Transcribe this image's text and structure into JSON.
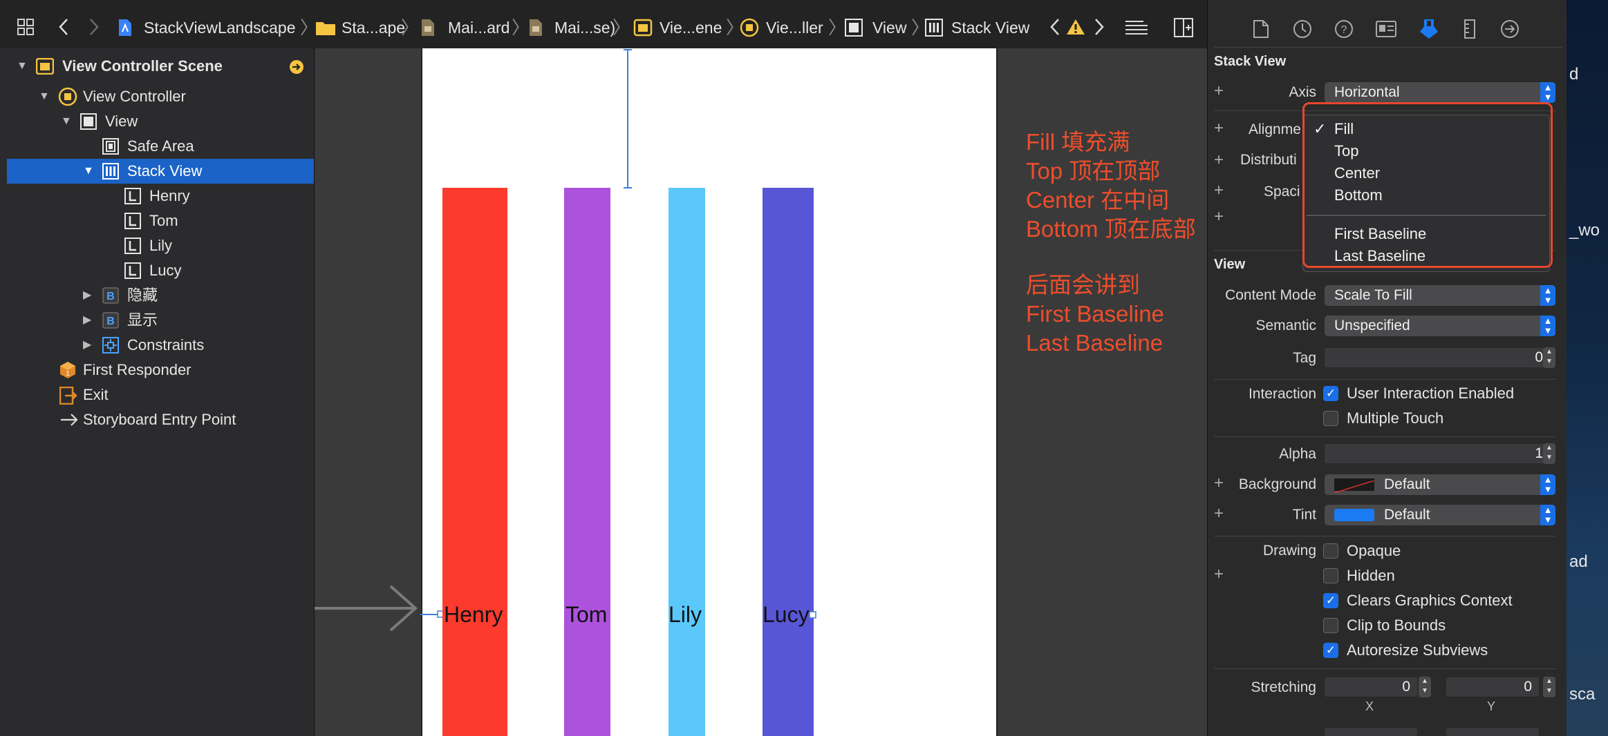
{
  "breadcrumb": {
    "items": [
      "StackViewLandscape",
      "Sta...ape",
      "Mai...ard",
      "Mai...se)",
      "Vie...ene",
      "Vie...ller",
      "View",
      "Stack View"
    ]
  },
  "navigator": {
    "scene_title": "View Controller Scene",
    "items": [
      "View Controller",
      "View",
      "Safe Area",
      "Stack View",
      "Henry",
      "Tom",
      "Lily",
      "Lucy",
      "隐藏",
      "显示",
      "Constraints",
      "First Responder",
      "Exit",
      "Storyboard Entry Point"
    ]
  },
  "canvas": {
    "bars": [
      {
        "label": "Henry",
        "color": "#fc3a2e"
      },
      {
        "label": "Tom",
        "color": "#ad52dc"
      },
      {
        "label": "Lily",
        "color": "#5ac8fa"
      },
      {
        "label": "Lucy",
        "color": "#5855d6"
      }
    ],
    "notes": {
      "fill": "Fill 填充满",
      "top": "Top 顶在顶部",
      "center": "Center 在中间",
      "bottom": "Bottom 顶在底部",
      "later": "后面会讲到",
      "first_baseline": "First Baseline",
      "last_baseline": "Last Baseline"
    }
  },
  "inspector": {
    "stack_view_title": "Stack View",
    "axis_label": "Axis",
    "axis_value": "Horizontal",
    "alignment_label": "Alignme",
    "distribution_label": "Distributi",
    "spacing_label": "Spaci",
    "view_title": "View",
    "content_mode_label": "Content Mode",
    "content_mode_value": "Scale To Fill",
    "semantic_label": "Semantic",
    "semantic_value": "Unspecified",
    "tag_label": "Tag",
    "tag_value": "0",
    "interaction_label": "Interaction",
    "user_interaction": "User Interaction Enabled",
    "multiple_touch": "Multiple Touch",
    "alpha_label": "Alpha",
    "alpha_value": "1",
    "background_label": "Background",
    "background_value": "Default",
    "tint_label": "Tint",
    "tint_value": "Default",
    "drawing_label": "Drawing",
    "opaque": "Opaque",
    "hidden": "Hidden",
    "clears_graphics": "Clears Graphics Context",
    "clip_to_bounds": "Clip to Bounds",
    "autoresize": "Autoresize Subviews",
    "stretching_label": "Stretching",
    "stretch_x_value": "0",
    "stretch_y_value": "0",
    "x_label": "X",
    "y_label": "Y",
    "tint_color": "#1a7bf2",
    "accent": "#1a6fe6"
  },
  "dropdown": {
    "checkmark": "✓",
    "options": [
      "Fill",
      "Top",
      "Center",
      "Bottom",
      "First Baseline",
      "Last Baseline"
    ],
    "selected": "Fill"
  },
  "desktop": {
    "labels": [
      "d",
      "_wo",
      "ad",
      "sca"
    ]
  }
}
